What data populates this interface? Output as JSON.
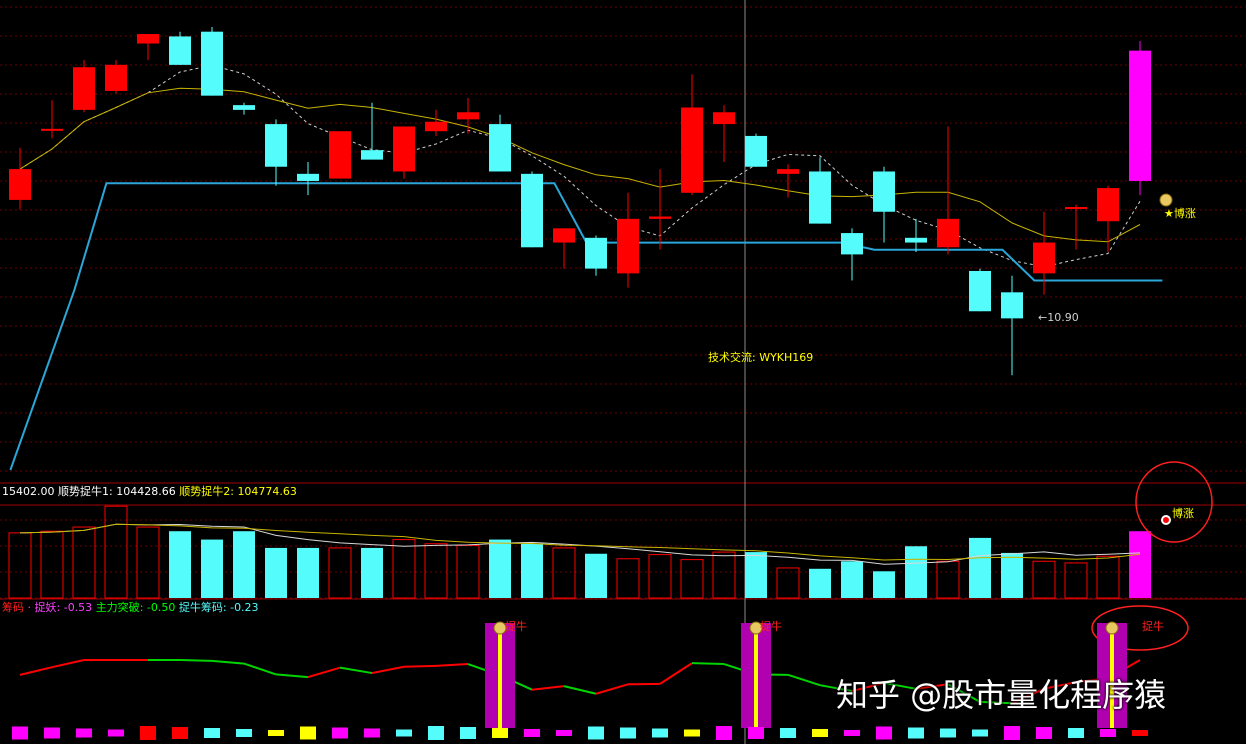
{
  "colors": {
    "up": "#ff0000",
    "down": "#54fcfc",
    "magenta": "#ff00ff",
    "ma_yellow": "#c8b400",
    "ma_dashed": "#cfcfcf",
    "line_blue": "#2aa6d8",
    "label_yellow": "#ffff00",
    "grid": "#6b0000",
    "panel_border": "#a00000",
    "green": "#00d400",
    "purple": "#b000b0"
  },
  "annotations": {
    "tech": "技术交流: WYKH169",
    "low_price": "←10.90",
    "bozhang_top": "★博涨",
    "bozhang_mid": "博涨",
    "zhuoniu": "捉牛"
  },
  "watermark": "知乎 @股市量化程序猿",
  "chart_data": [
    {
      "type": "candlestick",
      "panel": "price",
      "x": [
        1,
        2,
        3,
        4,
        5,
        6,
        7,
        8,
        9,
        10,
        11,
        12,
        13,
        14,
        15,
        16,
        17,
        18,
        19,
        20,
        21,
        22,
        23,
        24,
        25,
        26,
        27,
        28,
        29,
        30,
        31,
        32,
        33,
        34,
        35,
        36,
        37
      ],
      "candles": [
        {
          "o": 0,
          "h": 0,
          "l": 0,
          "c": 0
        },
        {
          "o": 11.74,
          "h": 11.96,
          "l": 11.7,
          "c": 11.87
        },
        {
          "o": 12.04,
          "h": 12.16,
          "l": 12.0,
          "c": 12.04
        },
        {
          "o": 12.12,
          "h": 12.33,
          "l": 12.11,
          "c": 12.3
        },
        {
          "o": 12.2,
          "h": 12.33,
          "l": 12.19,
          "c": 12.31
        },
        {
          "o": 12.4,
          "h": 12.44,
          "l": 12.33,
          "c": 12.44
        },
        {
          "o": 12.43,
          "h": 12.45,
          "l": 12.31,
          "c": 12.31
        },
        {
          "o": 12.45,
          "h": 12.47,
          "l": 12.18,
          "c": 12.18
        },
        {
          "o": 12.14,
          "h": 12.15,
          "l": 12.1,
          "c": 12.12
        },
        {
          "o": 12.06,
          "h": 12.08,
          "l": 11.8,
          "c": 11.88
        },
        {
          "o": 11.85,
          "h": 11.9,
          "l": 11.76,
          "c": 11.82
        },
        {
          "o": 11.83,
          "h": 12.03,
          "l": 11.83,
          "c": 12.03
        },
        {
          "o": 11.95,
          "h": 12.15,
          "l": 11.93,
          "c": 11.91
        },
        {
          "o": 11.86,
          "h": 12.05,
          "l": 11.83,
          "c": 12.05
        },
        {
          "o": 12.03,
          "h": 12.12,
          "l": 12.01,
          "c": 12.07
        },
        {
          "o": 12.08,
          "h": 12.17,
          "l": 12.02,
          "c": 12.11
        },
        {
          "o": 12.06,
          "h": 12.1,
          "l": 11.86,
          "c": 11.86
        },
        {
          "o": 11.85,
          "h": 11.86,
          "l": 11.54,
          "c": 11.54
        },
        {
          "o": 11.56,
          "h": 11.62,
          "l": 11.45,
          "c": 11.62
        },
        {
          "o": 11.58,
          "h": 11.59,
          "l": 11.42,
          "c": 11.45
        },
        {
          "o": 11.43,
          "h": 11.77,
          "l": 11.37,
          "c": 11.66
        },
        {
          "o": 11.66,
          "h": 11.87,
          "l": 11.53,
          "c": 11.67
        },
        {
          "o": 11.77,
          "h": 12.27,
          "l": 11.76,
          "c": 12.13
        },
        {
          "o": 12.06,
          "h": 12.14,
          "l": 11.9,
          "c": 12.11
        },
        {
          "o": 12.01,
          "h": 12.02,
          "l": 11.88,
          "c": 11.88
        },
        {
          "o": 11.85,
          "h": 11.89,
          "l": 11.75,
          "c": 11.87
        },
        {
          "o": 11.86,
          "h": 11.92,
          "l": 11.64,
          "c": 11.64
        },
        {
          "o": 11.6,
          "h": 11.62,
          "l": 11.4,
          "c": 11.51
        },
        {
          "o": 11.86,
          "h": 11.88,
          "l": 11.56,
          "c": 11.69
        },
        {
          "o": 11.58,
          "h": 11.66,
          "l": 11.52,
          "c": 11.56
        },
        {
          "o": 11.54,
          "h": 12.05,
          "l": 11.51,
          "c": 11.66
        },
        {
          "o": 11.44,
          "h": 11.45,
          "l": 11.27,
          "c": 11.27
        },
        {
          "o": 11.35,
          "h": 11.42,
          "l": 11.0,
          "c": 11.24
        },
        {
          "o": 11.43,
          "h": 11.69,
          "l": 11.34,
          "c": 11.56
        },
        {
          "o": 11.71,
          "h": 11.72,
          "l": 11.53,
          "c": 11.71
        },
        {
          "o": 11.65,
          "h": 11.8,
          "l": 11.52,
          "c": 11.79
        },
        {
          "o": 11.82,
          "h": 12.41,
          "l": 11.76,
          "c": 12.37
        }
      ],
      "ylim": [
        10.6,
        12.55
      ],
      "low_marker": "10.90"
    },
    {
      "type": "bar",
      "panel": "volume",
      "header": {
        "field1": "15402.00",
        "name2": "顺势捉牛1",
        "field2": "104428.66",
        "name3": "顺势捉牛2",
        "field3": "104774.63"
      },
      "values": [
        80,
        78,
        80,
        85,
        110,
        85,
        80,
        70,
        80,
        60,
        60,
        60,
        60,
        70,
        65,
        63,
        70,
        65,
        60,
        53,
        47,
        52,
        46,
        55,
        55,
        36,
        35,
        44,
        32,
        62,
        44,
        72,
        54,
        44,
        42,
        50,
        80
      ]
    },
    {
      "type": "line",
      "panel": "indicator",
      "header": {
        "name1": "筹码",
        "name2": "捉妖",
        "value2": "-0.53",
        "name3": "主力突破",
        "value3": "-0.50",
        "name4": "捉牛筹码",
        "value4": "-0.23"
      },
      "signal_label": "捉牛",
      "signal_positions": [
        16,
        24,
        36
      ]
    }
  ]
}
